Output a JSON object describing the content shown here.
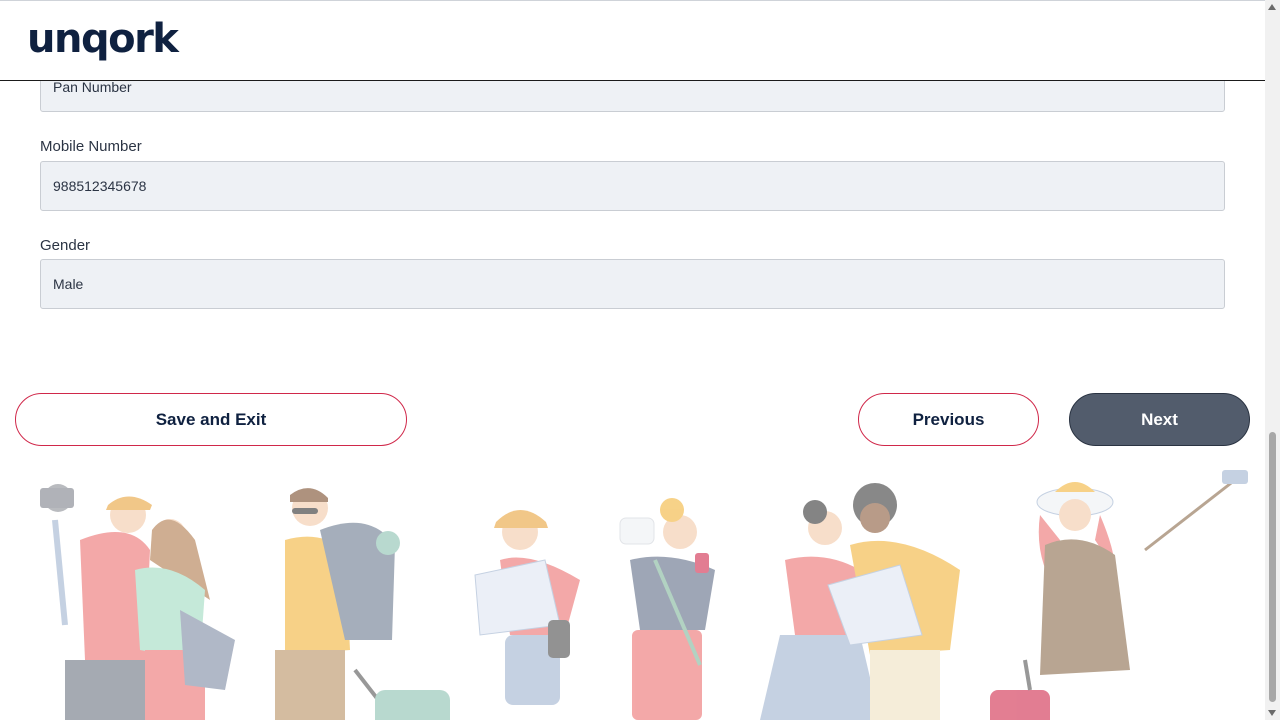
{
  "header": {
    "logo": "unqork"
  },
  "form": {
    "pan": {
      "value": "Pan Number"
    },
    "mobile": {
      "label": "Mobile Number",
      "value": "988512345678"
    },
    "gender": {
      "label": "Gender",
      "value": "Male"
    }
  },
  "buttons": {
    "save_exit": "Save and Exit",
    "previous": "Previous",
    "next": "Next"
  },
  "colors": {
    "brand_navy": "#0f2140",
    "accent_red": "#d0284a",
    "next_button": "#525c6c",
    "input_bg": "#eef1f5"
  }
}
